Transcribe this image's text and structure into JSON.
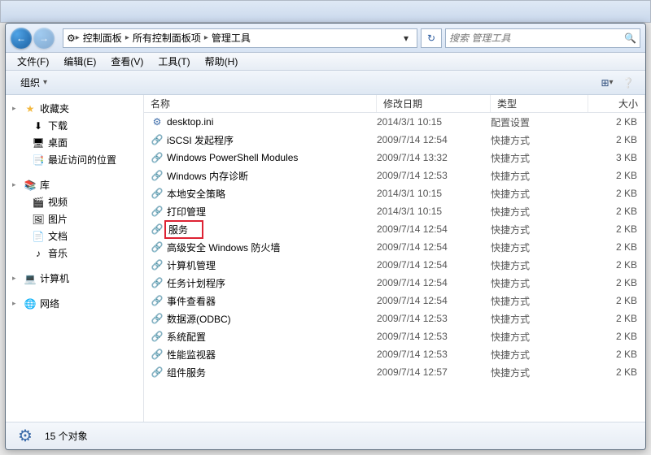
{
  "window_controls": {
    "min": "—",
    "max": "☐",
    "close": "✕"
  },
  "breadcrumbs": [
    "控制面板",
    "所有控制面板项",
    "管理工具"
  ],
  "search": {
    "placeholder": "搜索 管理工具"
  },
  "menubar": [
    {
      "label": "文件(F)"
    },
    {
      "label": "编辑(E)"
    },
    {
      "label": "查看(V)"
    },
    {
      "label": "工具(T)"
    },
    {
      "label": "帮助(H)"
    }
  ],
  "toolbar": {
    "organize": "组织"
  },
  "sidebar": {
    "groups": [
      {
        "head": "收藏夹",
        "icon": "star",
        "items": [
          {
            "label": "下载",
            "icon": "download"
          },
          {
            "label": "桌面",
            "icon": "desktop"
          },
          {
            "label": "最近访问的位置",
            "icon": "recent"
          }
        ]
      },
      {
        "head": "库",
        "icon": "library",
        "items": [
          {
            "label": "视频",
            "icon": "video"
          },
          {
            "label": "图片",
            "icon": "picture"
          },
          {
            "label": "文档",
            "icon": "document"
          },
          {
            "label": "音乐",
            "icon": "music"
          }
        ]
      },
      {
        "head": "计算机",
        "icon": "computer",
        "items": []
      },
      {
        "head": "网络",
        "icon": "network",
        "items": []
      }
    ]
  },
  "columns": {
    "name": "名称",
    "date": "修改日期",
    "type": "类型",
    "size": "大小"
  },
  "files": [
    {
      "name": "desktop.ini",
      "date": "2014/3/1 10:15",
      "type": "配置设置",
      "size": "2 KB",
      "icon": "ini"
    },
    {
      "name": "iSCSI 发起程序",
      "date": "2009/7/14 12:54",
      "type": "快捷方式",
      "size": "2 KB",
      "icon": "shortcut"
    },
    {
      "name": "Windows PowerShell Modules",
      "date": "2009/7/14 13:32",
      "type": "快捷方式",
      "size": "3 KB",
      "icon": "shortcut"
    },
    {
      "name": "Windows 内存诊断",
      "date": "2009/7/14 12:53",
      "type": "快捷方式",
      "size": "2 KB",
      "icon": "shortcut"
    },
    {
      "name": "本地安全策略",
      "date": "2014/3/1 10:15",
      "type": "快捷方式",
      "size": "2 KB",
      "icon": "shortcut"
    },
    {
      "name": "打印管理",
      "date": "2014/3/1 10:15",
      "type": "快捷方式",
      "size": "2 KB",
      "icon": "shortcut"
    },
    {
      "name": "服务",
      "date": "2009/7/14 12:54",
      "type": "快捷方式",
      "size": "2 KB",
      "icon": "shortcut",
      "highlight": true
    },
    {
      "name": "高级安全 Windows 防火墙",
      "date": "2009/7/14 12:54",
      "type": "快捷方式",
      "size": "2 KB",
      "icon": "shortcut"
    },
    {
      "name": "计算机管理",
      "date": "2009/7/14 12:54",
      "type": "快捷方式",
      "size": "2 KB",
      "icon": "shortcut"
    },
    {
      "name": "任务计划程序",
      "date": "2009/7/14 12:54",
      "type": "快捷方式",
      "size": "2 KB",
      "icon": "shortcut"
    },
    {
      "name": "事件查看器",
      "date": "2009/7/14 12:54",
      "type": "快捷方式",
      "size": "2 KB",
      "icon": "shortcut"
    },
    {
      "name": "数据源(ODBC)",
      "date": "2009/7/14 12:53",
      "type": "快捷方式",
      "size": "2 KB",
      "icon": "shortcut"
    },
    {
      "name": "系统配置",
      "date": "2009/7/14 12:53",
      "type": "快捷方式",
      "size": "2 KB",
      "icon": "shortcut"
    },
    {
      "name": "性能监视器",
      "date": "2009/7/14 12:53",
      "type": "快捷方式",
      "size": "2 KB",
      "icon": "shortcut"
    },
    {
      "name": "组件服务",
      "date": "2009/7/14 12:57",
      "type": "快捷方式",
      "size": "2 KB",
      "icon": "shortcut"
    }
  ],
  "status": {
    "count": "15 个对象"
  }
}
